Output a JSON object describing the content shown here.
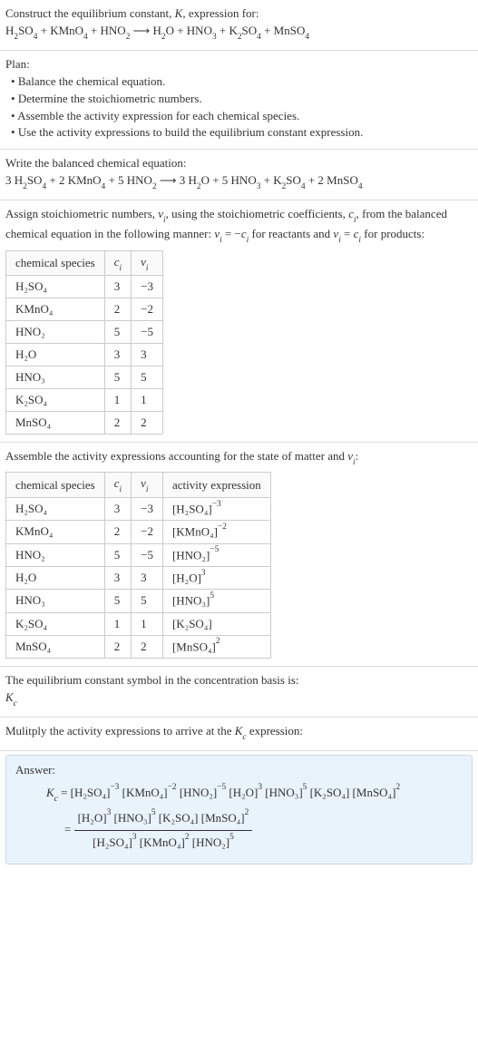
{
  "title_line1": "Construct the equilibrium constant, K, expression for:",
  "unbalanced_eq": "H₂SO₄ + KMnO₄ + HNO₂ ⟶ H₂O + HNO₃ + K₂SO₄ + MnSO₄",
  "plan_heading": "Plan:",
  "plan_items": [
    "Balance the chemical equation.",
    "Determine the stoichiometric numbers.",
    "Assemble the activity expression for each chemical species.",
    "Use the activity expressions to build the equilibrium constant expression."
  ],
  "balanced_heading": "Write the balanced chemical equation:",
  "balanced_eq": "3 H₂SO₄ + 2 KMnO₄ + 5 HNO₂ ⟶ 3 H₂O + 5 HNO₃ + K₂SO₄ + 2 MnSO₄",
  "assign_text": "Assign stoichiometric numbers, νᵢ, using the stoichiometric coefficients, cᵢ, from the balanced chemical equation in the following manner: νᵢ = −cᵢ for reactants and νᵢ = cᵢ for products:",
  "t1_headers": [
    "chemical species",
    "cᵢ",
    "νᵢ"
  ],
  "t1_rows": [
    {
      "s": "H₂SO₄",
      "c": "3",
      "v": "−3"
    },
    {
      "s": "KMnO₄",
      "c": "2",
      "v": "−2"
    },
    {
      "s": "HNO₂",
      "c": "5",
      "v": "−5"
    },
    {
      "s": "H₂O",
      "c": "3",
      "v": "3"
    },
    {
      "s": "HNO₃",
      "c": "5",
      "v": "5"
    },
    {
      "s": "K₂SO₄",
      "c": "1",
      "v": "1"
    },
    {
      "s": "MnSO₄",
      "c": "2",
      "v": "2"
    }
  ],
  "assemble_text": "Assemble the activity expressions accounting for the state of matter and νᵢ:",
  "t2_headers": [
    "chemical species",
    "cᵢ",
    "νᵢ",
    "activity expression"
  ],
  "t2_rows": [
    {
      "s": "H₂SO₄",
      "c": "3",
      "v": "−3",
      "ab": "[H₂SO₄]",
      "ae": "−3"
    },
    {
      "s": "KMnO₄",
      "c": "2",
      "v": "−2",
      "ab": "[KMnO₄]",
      "ae": "−2"
    },
    {
      "s": "HNO₂",
      "c": "5",
      "v": "−5",
      "ab": "[HNO₂]",
      "ae": "−5"
    },
    {
      "s": "H₂O",
      "c": "3",
      "v": "3",
      "ab": "[H₂O]",
      "ae": "3"
    },
    {
      "s": "HNO₃",
      "c": "5",
      "v": "5",
      "ab": "[HNO₃]",
      "ae": "5"
    },
    {
      "s": "K₂SO₄",
      "c": "1",
      "v": "1",
      "ab": "[K₂SO₄]",
      "ae": ""
    },
    {
      "s": "MnSO₄",
      "c": "2",
      "v": "2",
      "ab": "[MnSO₄]",
      "ae": "2"
    }
  ],
  "symbol_text": "The equilibrium constant symbol in the concentration basis is:",
  "symbol": "K_c",
  "mult_text": "Mulitply the activity expressions to arrive at the K_c expression:",
  "answer_label": "Answer:",
  "kc_line": {
    "lhs": "K_c = ",
    "prod_terms": [
      {
        "b": "[H₂SO₄]",
        "e": "−3"
      },
      {
        "b": "[KMnO₄]",
        "e": "−2"
      },
      {
        "b": "[HNO₂]",
        "e": "−5"
      },
      {
        "b": "[H₂O]",
        "e": "3"
      },
      {
        "b": "[HNO₃]",
        "e": "5"
      },
      {
        "b": "[K₂SO₄]",
        "e": ""
      },
      {
        "b": "[MnSO₄]",
        "e": "2"
      }
    ],
    "frac_eq": "= ",
    "num_terms": [
      {
        "b": "[H₂O]",
        "e": "3"
      },
      {
        "b": "[HNO₃]",
        "e": "5"
      },
      {
        "b": "[K₂SO₄]",
        "e": ""
      },
      {
        "b": "[MnSO₄]",
        "e": "2"
      }
    ],
    "den_terms": [
      {
        "b": "[H₂SO₄]",
        "e": "3"
      },
      {
        "b": "[KMnO₄]",
        "e": "2"
      },
      {
        "b": "[HNO₂]",
        "e": "5"
      }
    ]
  }
}
